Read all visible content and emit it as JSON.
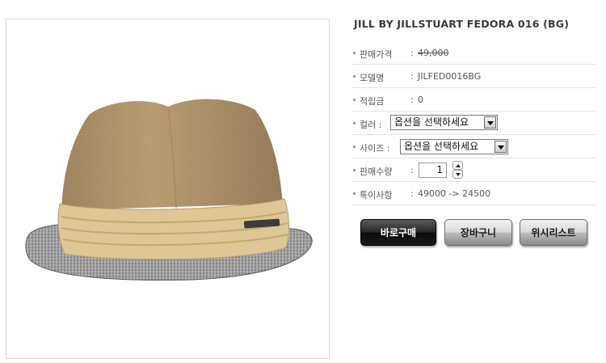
{
  "product": {
    "title": "JILL BY JILLSTUART FEDORA 016 (BG)",
    "image_alt": "product-photo-fedora"
  },
  "info": {
    "price": {
      "label": "판매가격",
      "colon": ":",
      "value": "49,000"
    },
    "model": {
      "label": "모델명",
      "colon": ":",
      "value": "JILFED0016BG"
    },
    "points": {
      "label": "적립금",
      "colon": ":",
      "value": "0"
    },
    "color": {
      "label": "컬러 :",
      "selected": "옵션을 선택하세요"
    },
    "size": {
      "label": "사이즈 :",
      "selected": "옵션을 선택하세요"
    },
    "quantity": {
      "label": "판매수량",
      "colon": ":",
      "value": "1"
    },
    "note": {
      "label": "특이사항",
      "colon": ":",
      "value": "49000 -> 24500"
    }
  },
  "buttons": {
    "buy": "바로구매",
    "cart": "장바구니",
    "wishlist": "위시리스트"
  },
  "colors": {
    "title": "#3a3a3a",
    "row_divider": "#e3e3e3",
    "buy_button": "#1a1a1a",
    "secondary_button": "#c8c8c8"
  }
}
